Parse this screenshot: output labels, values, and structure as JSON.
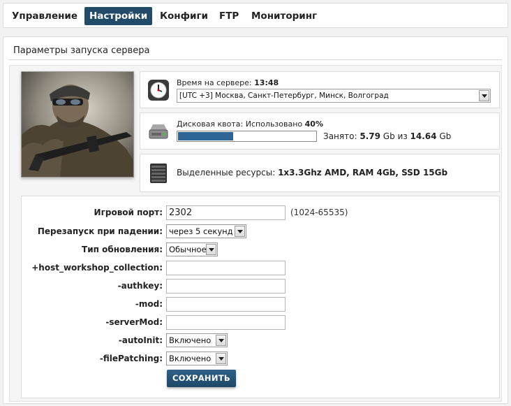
{
  "nav": {
    "items": [
      {
        "label": "Управление"
      },
      {
        "label": "Настройки",
        "active": true
      },
      {
        "label": "Конфиги"
      },
      {
        "label": "FTP"
      },
      {
        "label": "Мониторинг"
      }
    ]
  },
  "panel": {
    "title": "Параметры запуска сервера"
  },
  "server_time": {
    "label": "Время на сервере:",
    "value": "13:48",
    "timezone": "[UTC +3] Москва, Санкт-Петербург, Минск, Волгоград",
    "icon": "clock-icon"
  },
  "disk": {
    "label": "Дисковая квота: Использовано",
    "percent_text": "40%",
    "percent": 40,
    "used_prefix": "Занято:",
    "used": "5.79",
    "used_unit": "Gb",
    "of": "из",
    "total": "14.64",
    "total_unit": "Gb",
    "icon": "hard-drive-icon"
  },
  "resources": {
    "label": "Выделенные ресурсы:",
    "value": "1x3.3Ghz AMD, RAM 4Gb, SSD 15Gb",
    "icon": "server-rack-icon"
  },
  "form": {
    "port": {
      "label": "Игровой порт:",
      "value": "2302",
      "hint": "(1024-65535)"
    },
    "restart": {
      "label": "Перезапуск при падении:",
      "value": "через 5 секунд"
    },
    "update": {
      "label": "Тип обновления:",
      "value": "Обычное"
    },
    "workshop": {
      "label": "+host_workshop_collection:",
      "value": ""
    },
    "authkey": {
      "label": "-authkey:",
      "value": ""
    },
    "mod": {
      "label": "-mod:",
      "value": ""
    },
    "servermod": {
      "label": "-serverMod:",
      "value": ""
    },
    "autoinit": {
      "label": "-autoInit:",
      "value": "Включено"
    },
    "filepatching": {
      "label": "-filePatching:",
      "value": "Включено"
    },
    "save_label": "СОХРАНИТЬ"
  },
  "colors": {
    "accent": "#224b6a",
    "progress": "#2e6496"
  }
}
